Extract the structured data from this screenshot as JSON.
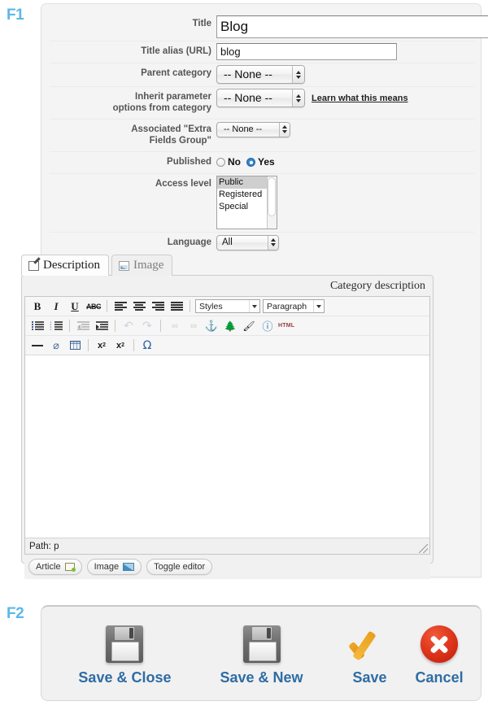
{
  "figures": {
    "f1_label": "F1",
    "f2_label": "F2"
  },
  "form": {
    "rows": [
      {
        "label": "Title",
        "value": "Blog"
      },
      {
        "label": "Title alias (URL)",
        "value": "blog"
      },
      {
        "label": "Parent category",
        "value": "-- None --"
      },
      {
        "label": "Inherit parameter\noptions from category",
        "value": "-- None --",
        "help_link": "Learn what this means"
      },
      {
        "label": "Associated \"Extra\nFields Group\"",
        "value": "-- None --"
      },
      {
        "label": "Published"
      },
      {
        "label": "Access level"
      },
      {
        "label": "Language",
        "value": "All"
      }
    ],
    "title_label": "Title",
    "title_value": "Blog",
    "alias_label": "Title alias (URL)",
    "alias_value": "blog",
    "parent_label": "Parent category",
    "parent_value": "-- None --",
    "inherit_label_line1": "Inherit parameter",
    "inherit_label_line2": "options from category",
    "inherit_value": "-- None --",
    "inherit_help": "Learn what this means",
    "extrafields_label_line1": "Associated \"Extra",
    "extrafields_label_line2": "Fields Group\"",
    "extrafields_value": "-- None --",
    "published_label": "Published",
    "published_no": "No",
    "published_yes": "Yes",
    "published_selected": "Yes",
    "access_label": "Access level",
    "access_options": [
      "Public",
      "Registered",
      "Special"
    ],
    "access_selected": "Public",
    "language_label": "Language",
    "language_value": "All"
  },
  "tabs": [
    {
      "label": "Description",
      "icon": "pencil-icon",
      "active": true
    },
    {
      "label": "Image",
      "icon": "image-icon",
      "active": false
    }
  ],
  "editor": {
    "heading": "Category description",
    "toolbar_row1": [
      {
        "name": "bold",
        "glyph": "B"
      },
      {
        "name": "italic",
        "glyph": "I"
      },
      {
        "name": "underline",
        "glyph": "U"
      },
      {
        "name": "strikethrough",
        "glyph": "ABC"
      },
      {
        "name": "align-left",
        "glyph": ""
      },
      {
        "name": "align-center",
        "glyph": ""
      },
      {
        "name": "align-right",
        "glyph": ""
      },
      {
        "name": "align-justify",
        "glyph": ""
      }
    ],
    "styles_select": "Styles",
    "format_select": "Paragraph",
    "toolbar_row2": [
      {
        "name": "bullet-list",
        "glyph": ""
      },
      {
        "name": "numbered-list",
        "glyph": ""
      },
      {
        "name": "outdent",
        "glyph": ""
      },
      {
        "name": "indent",
        "glyph": ""
      },
      {
        "name": "undo",
        "glyph": "↶"
      },
      {
        "name": "redo",
        "glyph": "↷"
      },
      {
        "name": "insert-link",
        "glyph": "∞"
      },
      {
        "name": "unlink",
        "glyph": "∞"
      },
      {
        "name": "anchor",
        "glyph": "⚓"
      },
      {
        "name": "insert-image",
        "glyph": "🌲"
      },
      {
        "name": "cleanup",
        "glyph": "🖌"
      },
      {
        "name": "help",
        "glyph": "?"
      },
      {
        "name": "edit-html",
        "glyph": "HTML"
      }
    ],
    "toolbar_row3": [
      {
        "name": "horizontal-rule",
        "glyph": ""
      },
      {
        "name": "remove-format",
        "glyph": "⌀"
      },
      {
        "name": "insert-table",
        "glyph": ""
      },
      {
        "name": "subscript",
        "glyph": "x"
      },
      {
        "name": "superscript",
        "glyph": "x"
      },
      {
        "name": "special-character",
        "glyph": "Ω"
      }
    ],
    "content": "",
    "path_label": "Path:",
    "path_value": "p",
    "buttons": [
      {
        "label": "Article",
        "icon": "article-icon"
      },
      {
        "label": "Image",
        "icon": "image-icon"
      },
      {
        "label": "Toggle editor",
        "icon": null
      }
    ]
  },
  "actionbar": {
    "buttons": [
      {
        "label": "Save & Close",
        "icon": "floppy-disk-icon"
      },
      {
        "label": "Save & New",
        "icon": "floppy-disk-icon"
      },
      {
        "label": "Save",
        "icon": "check-icon"
      },
      {
        "label": "Cancel",
        "icon": "cancel-icon"
      }
    ]
  },
  "colors": {
    "figure_label": "#5bb8e8",
    "action_label": "#2e6ca3",
    "panel_bg": "#f4f4f4",
    "cancel_red": "#e23b20",
    "check_orange": "#e8a01c"
  }
}
